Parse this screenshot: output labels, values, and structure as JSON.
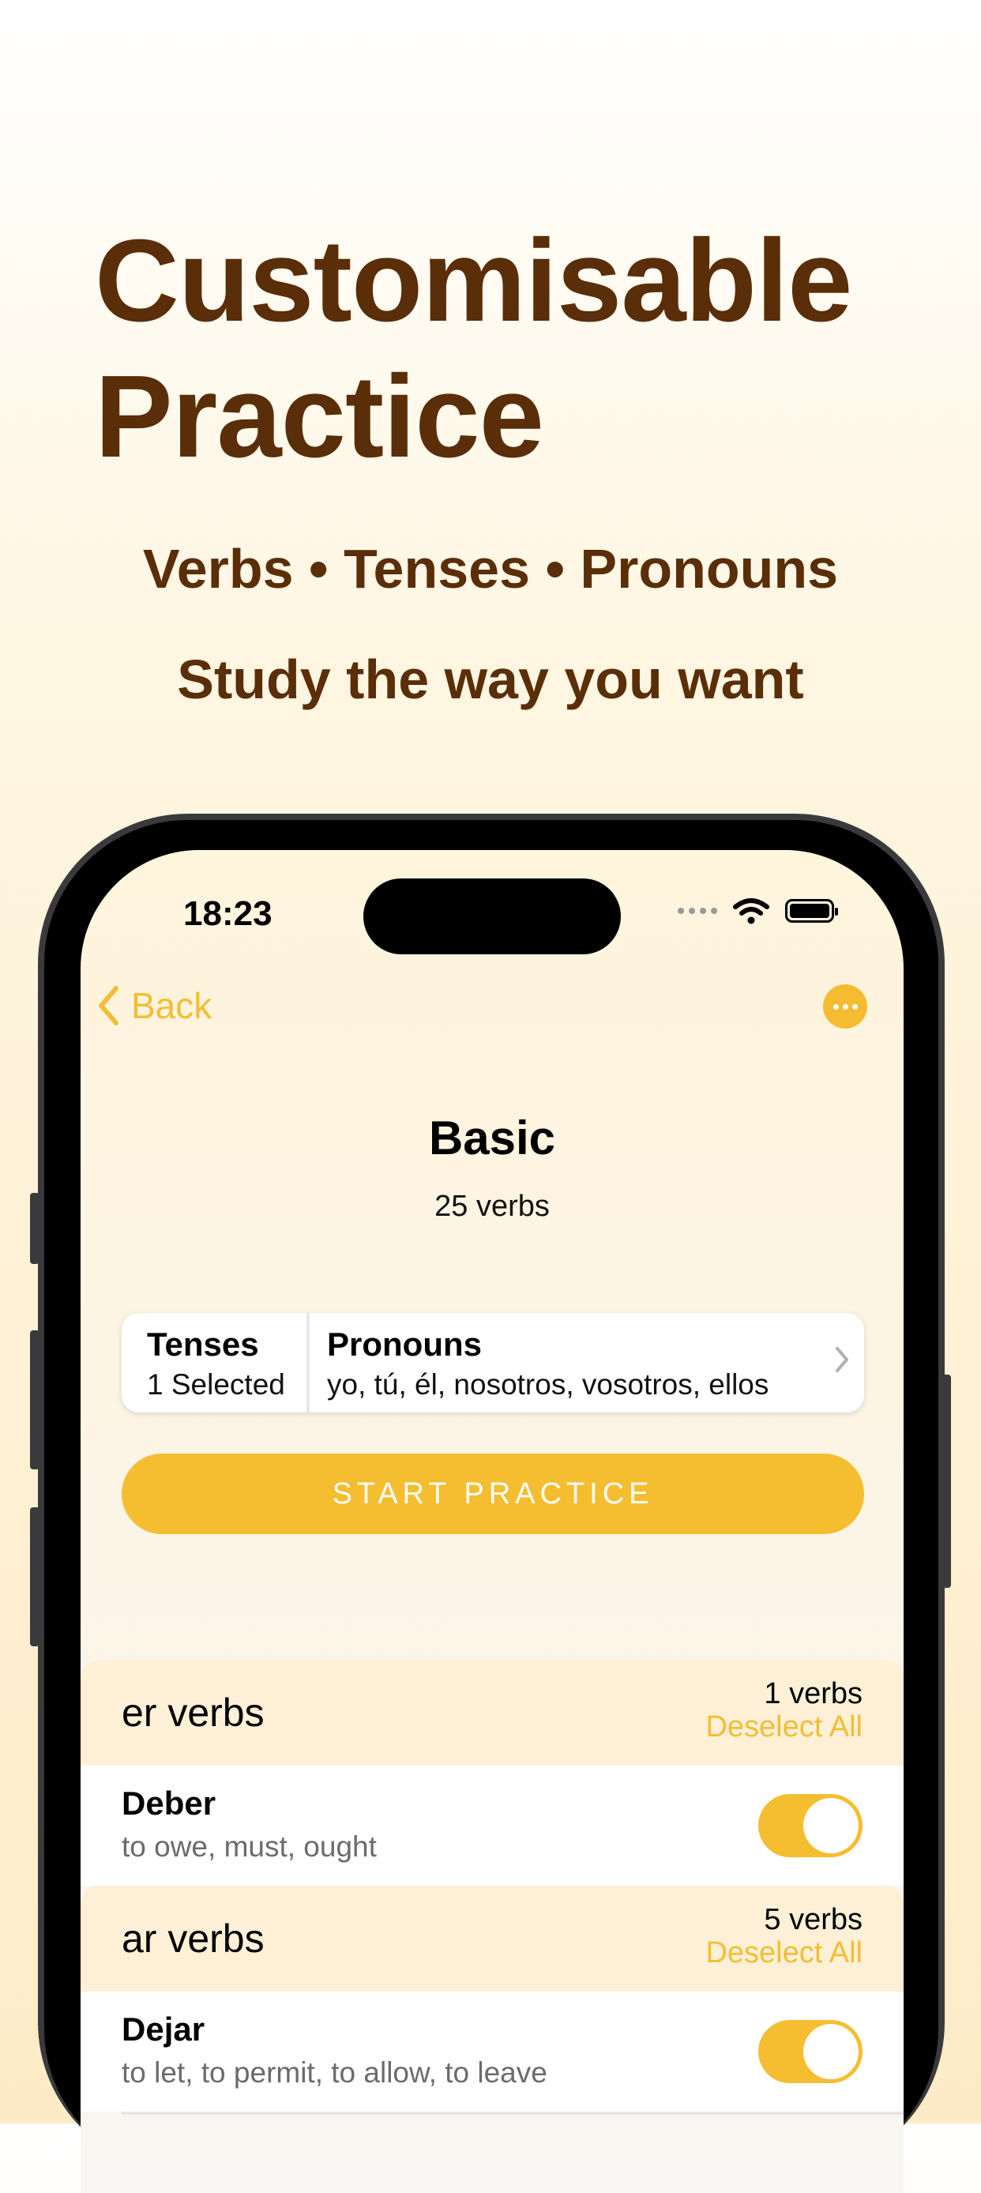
{
  "promo": {
    "headline_line1": "Customisable",
    "headline_line2": "Practice",
    "subtitle": "Verbs • Tenses • Pronouns",
    "tagline": "Study the way you want"
  },
  "status_bar": {
    "time": "18:23"
  },
  "nav": {
    "back_label": "Back"
  },
  "deck": {
    "title": "Basic",
    "count": "25 verbs"
  },
  "filters": {
    "tenses_label": "Tenses",
    "tenses_value": "1 Selected",
    "pronouns_label": "Pronouns",
    "pronouns_value": "yo, tú, él, nosotros, vosotros, ellos"
  },
  "start_button": "START PRACTICE",
  "sections": [
    {
      "name": "er verbs",
      "count": "1 verbs",
      "deselect": "Deselect All",
      "verbs": [
        {
          "name": "Deber",
          "meaning": "to owe, must, ought",
          "enabled": true
        }
      ]
    },
    {
      "name": "ar verbs",
      "count": "5 verbs",
      "deselect": "Deselect All",
      "verbs": [
        {
          "name": "Dejar",
          "meaning": "to let, to permit, to allow, to leave",
          "enabled": true
        }
      ]
    }
  ],
  "colors": {
    "accent": "#f5bd30",
    "headline": "#5a2e08"
  },
  "icons": [
    "chevron-left-icon",
    "more-icon",
    "wifi-icon",
    "battery-icon",
    "chevron-right-icon"
  ]
}
